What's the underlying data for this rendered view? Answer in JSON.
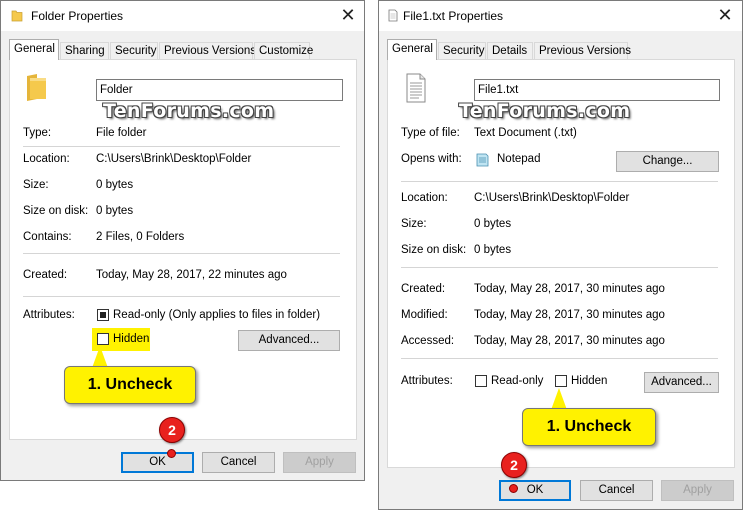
{
  "watermark": "TenForums.com",
  "callouts": {
    "step1": "1. Uncheck",
    "step2": "2"
  },
  "folder_dialog": {
    "title": "Folder Properties",
    "close_glyph": "✕",
    "tabs": [
      "General",
      "Sharing",
      "Security",
      "Previous Versions",
      "Customize"
    ],
    "name_value": "Folder",
    "rows": {
      "type": {
        "label": "Type:",
        "value": "File folder"
      },
      "location": {
        "label": "Location:",
        "value": "C:\\Users\\Brink\\Desktop\\Folder"
      },
      "size": {
        "label": "Size:",
        "value": "0 bytes"
      },
      "size_on_disk": {
        "label": "Size on disk:",
        "value": "0 bytes"
      },
      "contains": {
        "label": "Contains:",
        "value": "2 Files, 0 Folders"
      },
      "created": {
        "label": "Created:",
        "value": "Today, May 28, 2017, 22 minutes ago"
      }
    },
    "attributes_label": "Attributes:",
    "readonly_label": "Read-only (Only applies to files in folder)",
    "readonly_state": "partial",
    "hidden_label": "Hidden",
    "hidden_checked": false,
    "advanced_button": "Advanced...",
    "ok_button": "OK",
    "cancel_button": "Cancel",
    "apply_button": "Apply"
  },
  "file_dialog": {
    "title": "File1.txt Properties",
    "close_glyph": "✕",
    "tabs": [
      "General",
      "Security",
      "Details",
      "Previous Versions"
    ],
    "name_value": "File1.txt",
    "rows": {
      "type": {
        "label": "Type of file:",
        "value": "Text Document (.txt)"
      },
      "opens_with": {
        "label": "Opens with:",
        "value": "Notepad"
      },
      "location": {
        "label": "Location:",
        "value": "C:\\Users\\Brink\\Desktop\\Folder"
      },
      "size": {
        "label": "Size:",
        "value": "0 bytes"
      },
      "size_on_disk": {
        "label": "Size on disk:",
        "value": "0 bytes"
      },
      "created": {
        "label": "Created:",
        "value": "Today, May 28, 2017, 30 minutes ago"
      },
      "modified": {
        "label": "Modified:",
        "value": "Today, May 28, 2017, 30 minutes ago"
      },
      "accessed": {
        "label": "Accessed:",
        "value": "Today, May 28, 2017, 30 minutes ago"
      }
    },
    "change_button": "Change...",
    "attributes_label": "Attributes:",
    "readonly_label": "Read-only",
    "hidden_label": "Hidden",
    "advanced_button": "Advanced...",
    "ok_button": "OK",
    "cancel_button": "Cancel",
    "apply_button": "Apply"
  },
  "colors": {
    "accent": "#0078d7",
    "highlight": "#fff200",
    "badge": "#e8211e",
    "folder": "#f5c94c"
  },
  "icons": [
    "folder-icon",
    "file-icon",
    "notepad-icon",
    "close-icon"
  ]
}
